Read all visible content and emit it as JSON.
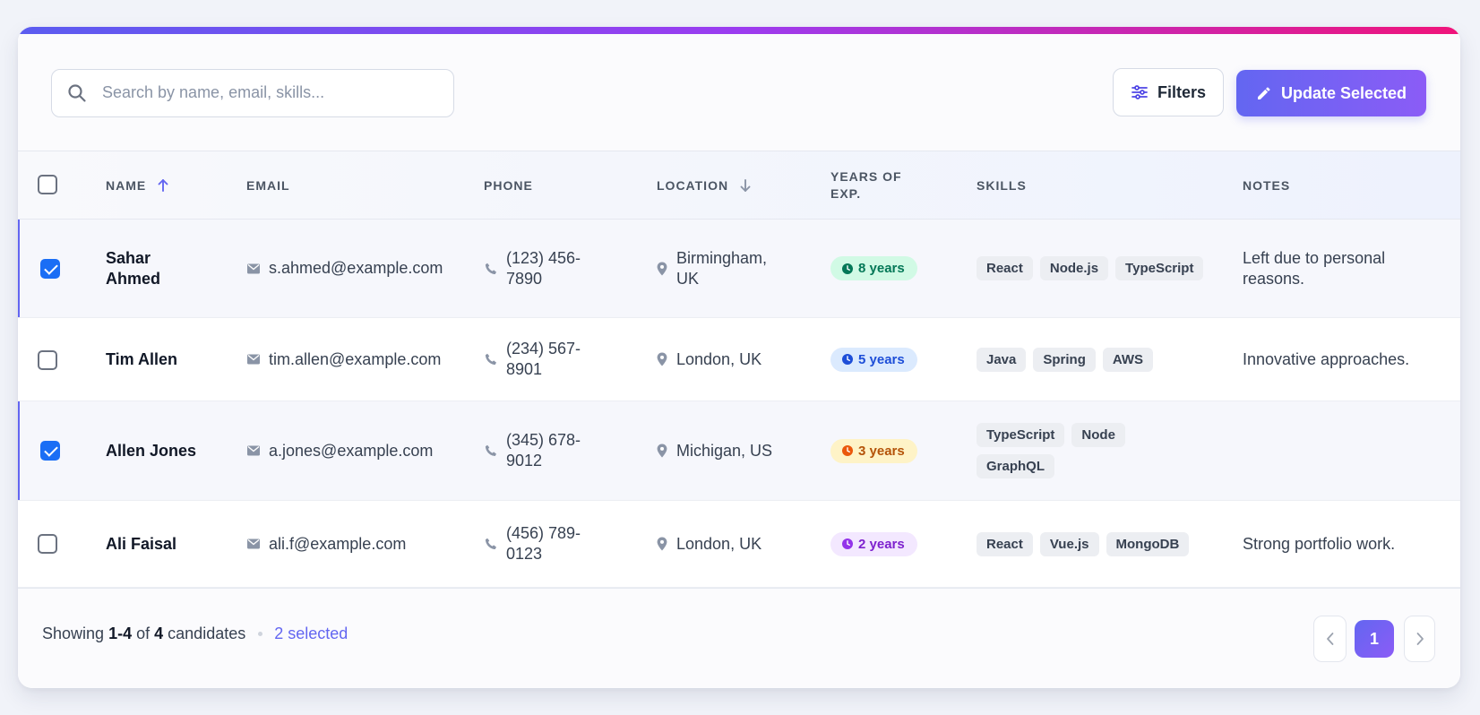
{
  "toolbar": {
    "search_placeholder": "Search by name, email, skills...",
    "filters_label": "Filters",
    "update_label": "Update Selected"
  },
  "table": {
    "columns": {
      "name": "NAME",
      "email": "EMAIL",
      "phone": "PHONE",
      "location": "LOCATION",
      "years_line1": "YEARS OF",
      "years_line2": "EXP.",
      "skills": "SKILLS",
      "notes": "NOTES"
    },
    "rows": [
      {
        "selected": true,
        "name_line1": "Sahar",
        "name_line2": "Ahmed",
        "email": "s.ahmed@example.com",
        "phone_line1": "(123) 456-",
        "phone_line2": "7890",
        "location_line1": "Birmingham,",
        "location_line2": "UK",
        "years": "8 years",
        "skills": [
          "React",
          "Node.js",
          "TypeScript"
        ],
        "notes_line1": "Left due to personal",
        "notes_line2": "reasons."
      },
      {
        "selected": false,
        "name_line1": "Tim Allen",
        "email": "tim.allen@example.com",
        "phone_line1": "(234) 567-",
        "phone_line2": "8901",
        "location_line1": "London, UK",
        "years": "5 years",
        "skills": [
          "Java",
          "Spring",
          "AWS"
        ],
        "notes_line1": "Innovative approaches."
      },
      {
        "selected": true,
        "name_line1": "Allen Jones",
        "email": "a.jones@example.com",
        "phone_line1": "(345) 678-",
        "phone_line2": "9012",
        "location_line1": "Michigan, US",
        "years": "3 years",
        "skills": [
          "TypeScript",
          "Node",
          "GraphQL"
        ],
        "notes_line1": ""
      },
      {
        "selected": false,
        "name_line1": "Ali Faisal",
        "email": "ali.f@example.com",
        "phone_line1": "(456) 789-",
        "phone_line2": "0123",
        "location_line1": "London, UK",
        "years": "2 years",
        "skills": [
          "React",
          "Vue.js",
          "MongoDB"
        ],
        "notes_line1": "Strong portfolio work."
      }
    ]
  },
  "footer": {
    "showing_prefix": "Showing",
    "range": "1-4",
    "of": "of",
    "total": "4",
    "suffix": "candidates",
    "selected_text": "2 selected",
    "current_page": "1"
  },
  "icons": {
    "search": "search-icon",
    "filters": "sliders-icon",
    "update": "pencil-icon",
    "sort_name": "arrow-up-icon",
    "sort_location": "arrow-down-icon",
    "email": "mail-icon",
    "phone": "phone-icon",
    "location": "map-pin-icon",
    "years": "clock-icon",
    "prev": "chevron-left-icon",
    "next": "chevron-right-icon"
  },
  "colors": {
    "accent": "#6366f1",
    "accent_gradient_end": "#f0147a",
    "checkbox_checked": "#1a6ef5",
    "years_8_bg": "#d1fae5",
    "years_8_fg": "#047857",
    "years_5_bg": "#dbeafe",
    "years_5_fg": "#1d4ed8",
    "years_3_bg": "#fef3c7",
    "years_3_fg": "#b45309",
    "years_2_bg": "#f3e8ff",
    "years_2_fg": "#7e22ce"
  }
}
